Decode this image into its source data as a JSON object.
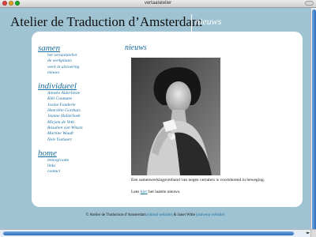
{
  "window": {
    "title": "vertaalatelier"
  },
  "header": {
    "site_title": "Atelier de Traduction d’Amsterdam",
    "section_title": "nieuws"
  },
  "nav": {
    "groups": [
      {
        "heading": "samen",
        "items": [
          "het vertaalatelier",
          "de werkplaats",
          "werk in uitvoering",
          "nieuws"
        ]
      },
      {
        "heading": "individueel",
        "items": [
          "Anneke Alderlieste",
          "Kiki Coumans",
          "Josine Fonderie",
          "Henriëtte Gorthuis",
          "Jeanne Holierhoek",
          "Mirjam de Veth",
          "Rosalien van Witsen",
          "Martine Woudt",
          "Nele Ysebaert"
        ]
      },
      {
        "heading": "home",
        "items": [
          "lettergrootte",
          "links",
          "contact"
        ]
      }
    ]
  },
  "content": {
    "title": "nieuws",
    "photo_icon": "vintage-portrait-photo",
    "paragraph1": "Een samenwerkingsverband van negen vertalers is voortdurend in beweging.",
    "paragraph2_before": "Lees",
    "paragraph2_link": "hier",
    "paragraph2_after": "het laatste nieuws."
  },
  "footer": {
    "copyright": "© Atelier de Traduction d’Amsterdam",
    "link1": "(sitoud website)",
    "and_text": "& Janet Witte",
    "link2": "(ontwerp website)"
  },
  "colors": {
    "page_background": "#9fc3d2",
    "link": "#1a6d9e",
    "panel": "#ffffff"
  }
}
